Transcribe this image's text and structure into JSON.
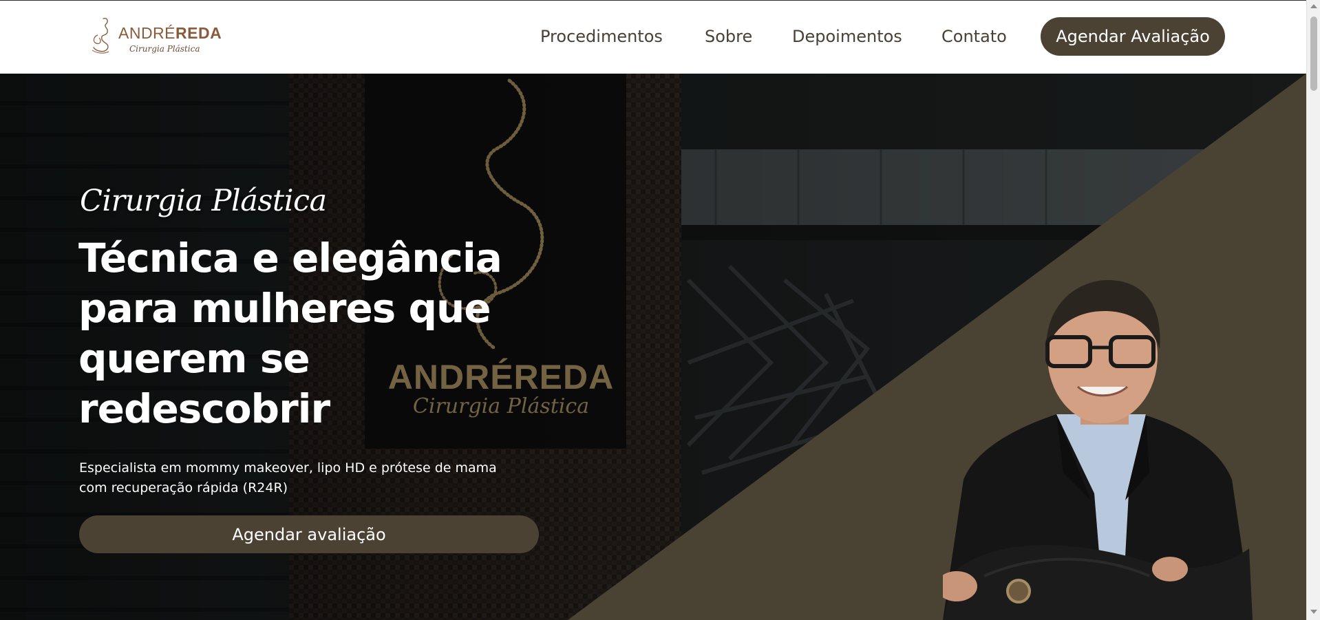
{
  "header": {
    "logo": {
      "name_part1": "ANDRÉ",
      "name_part2": "REDA",
      "subtitle": "Cirurgia Plástica",
      "icon": "silhouette-logo-icon"
    },
    "nav": [
      {
        "label": "Procedimentos"
      },
      {
        "label": "Sobre"
      },
      {
        "label": "Depoimentos"
      },
      {
        "label": "Contato"
      }
    ],
    "cta_label": "Agendar Avaliação"
  },
  "hero": {
    "eyebrow": "Cirurgia Plástica",
    "title_lines": [
      "Técnica e elegância",
      "para mulheres que",
      "querem se",
      "redescobrir"
    ],
    "subtitle_lines": [
      "Especialista em mommy makeover, lipo HD e prótese de mama",
      "com recuperação rápida (R24R)"
    ],
    "cta_label": "Agendar avaliação",
    "sign": {
      "name": "ANDRÉREDA",
      "subtitle": "Cirurgia Plástica"
    }
  },
  "colors": {
    "brand_dark": "#4b4233",
    "logo_brown": "#8a5a3b",
    "nav_text": "#4a4036",
    "triangle": "#4a4232"
  }
}
